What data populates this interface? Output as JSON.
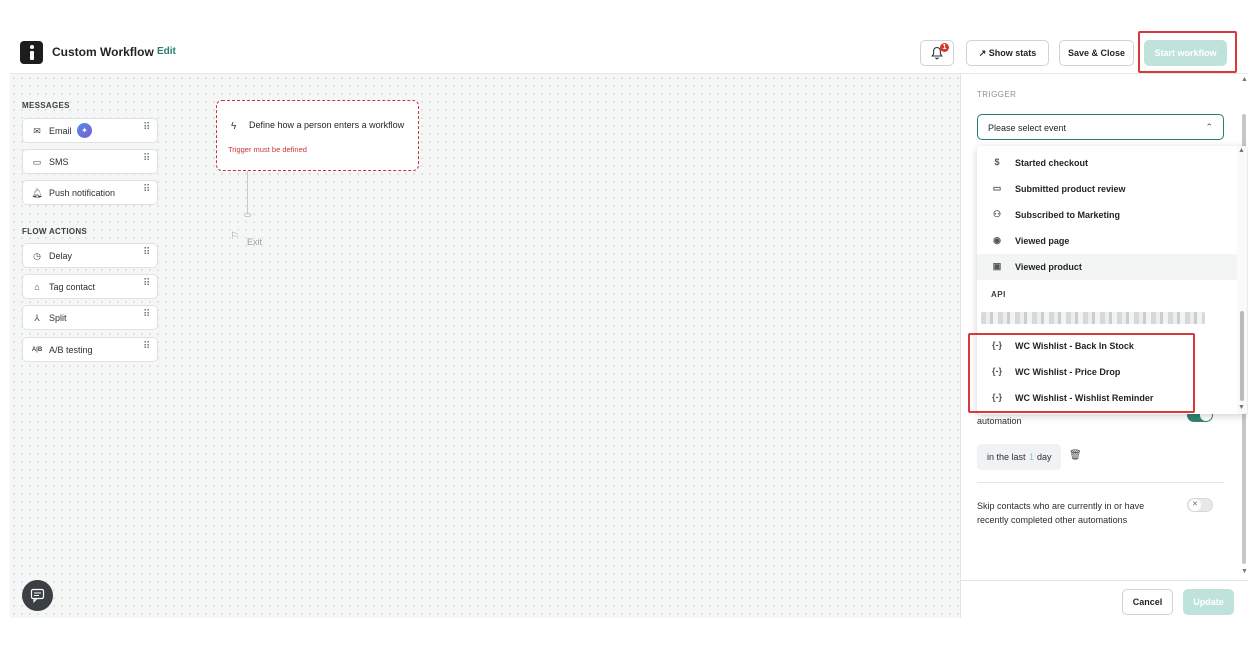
{
  "header": {
    "title": "Custom Workflow",
    "edit_label": "Edit",
    "notification_count": "1",
    "show_stats_label": "Show stats",
    "save_close_label": "Save & Close",
    "start_workflow_label": "Start workflow"
  },
  "palette": {
    "messages_heading": "MESSAGES",
    "messages": [
      {
        "label": "Email",
        "icon": "envelope-icon"
      },
      {
        "label": "SMS",
        "icon": "chat-bubble-icon"
      },
      {
        "label": "Push notification",
        "icon": "bell-icon"
      }
    ],
    "flow_heading": "FLOW ACTIONS",
    "flow_actions": [
      {
        "label": "Delay",
        "icon": "clock-icon"
      },
      {
        "label": "Tag contact",
        "icon": "tag-icon"
      },
      {
        "label": "Split",
        "icon": "split-icon"
      },
      {
        "label": "A/B testing",
        "icon": "ab-icon",
        "glyph": "A|B"
      }
    ]
  },
  "canvas": {
    "trigger_text": "Define how a person enters a workflow",
    "trigger_error": "Trigger must be defined",
    "exit_label": "Exit"
  },
  "panel": {
    "trigger_label": "TRIGGER",
    "select_value": "Please select event",
    "options": [
      {
        "label": "Started checkout",
        "icon": "dollar-doc-icon"
      },
      {
        "label": "Submitted product review",
        "icon": "review-card-icon"
      },
      {
        "label": "Subscribed to Marketing",
        "icon": "user-plus-icon"
      },
      {
        "label": "Viewed page",
        "icon": "eye-icon"
      },
      {
        "label": "Viewed product",
        "icon": "product-box-icon"
      }
    ],
    "api_group": "API",
    "api_options": [
      {
        "label": "WC Wishlist - Back In Stock",
        "icon": "braces-icon"
      },
      {
        "label": "WC Wishlist - Price Drop",
        "icon": "braces-icon"
      },
      {
        "label": "WC Wishlist - Wishlist Reminder",
        "icon": "braces-icon"
      }
    ],
    "automation_text": "automation",
    "time_prefix": "in the last",
    "time_value": "1",
    "time_unit": "day",
    "skip_text": "Skip contacts who are currently in or have recently completed other automations",
    "cancel_label": "Cancel",
    "update_label": "Update"
  },
  "colors": {
    "accent": "#247d6e",
    "error": "#c9353a",
    "disabled_button": "#bfe3db",
    "highlight": "#d9393b"
  }
}
